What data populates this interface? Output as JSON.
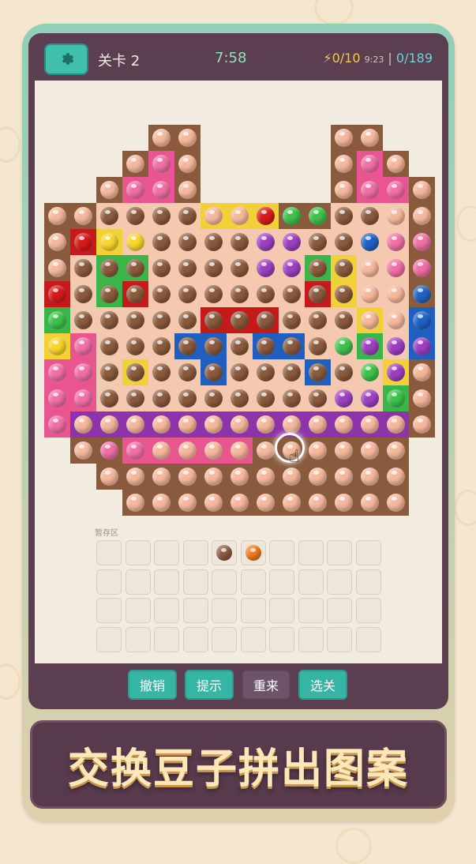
{
  "topbar": {
    "settings_icon": "gear-icon",
    "level_label": "关卡 2",
    "timer": "7:58",
    "energy_icon": "lightning-icon",
    "energy": "0/10",
    "energy_timer": "9:23",
    "separator": "|",
    "progress": "0/189"
  },
  "holding": {
    "label": "暂存区",
    "rows": 4,
    "cols": 10,
    "items": [
      {
        "slot": 4,
        "color": "brown"
      },
      {
        "slot": 5,
        "color": "orange"
      }
    ]
  },
  "bottom_buttons": [
    {
      "label": "撤销",
      "color": "#36b5a4"
    },
    {
      "label": "提示",
      "color": "#36b5a4"
    },
    {
      "label": "重来",
      "color": "#6e546a"
    },
    {
      "label": "选关",
      "color": "#36b5a4"
    }
  ],
  "banner": {
    "text": "交换豆子拼出图案"
  },
  "colors": {
    "peach": "#f6b79b",
    "brown": "#8a5a3c",
    "red": "#d8191b",
    "yellow": "#f7d52b",
    "green": "#3ec24a",
    "blue": "#1f63c6",
    "pink": "#f06fa4",
    "purple": "#9d3fc1",
    "orange": "#f07a1c"
  },
  "board": {
    "cols": 15,
    "rows": 15,
    "cells": [
      "....bb.....bb..",
      "...bPb.....bPb.",
      "..bPPb.....bPPb",
      "bbbbbbYYYbbbbbb",
      "bRYbbbbbbbbbbbb",
      "bbGGbbbbbbGYbbb",
      "RbGRbbbbbbRYbbb",
      "GbbbbbRRRbbbYbB",
      "YPbbbBBbBBbbGbB",
      "PPbYbbBbbbBbbYb",
      "PPbbbbbbbbbbbGb",
      "PVVVVVVVVVVVVVb",
      ".bbPPPPPbbbbbb.",
      "..bbbbbbbbbbbb.",
      "...bbbbbbbbbbb."
    ],
    "beads": [
      "....pp.....pp..",
      "...pPp.....pPp.",
      "..pPPp.....pPPp",
      "ppbbbbpprggbbpp",
      "pryybbbbVVbbBPP",
      "pbbbbbbbVVbbYPP",
      "rbbbbbbbbbbbYYB",
      "gbbbbbbbbbbbYYB",
      "yPbbbbbbbbbgVVV",
      "PPbbbbbbbbbbgVp",
      "PPbbbbbbbbbVVgp",
      "Ppppppppppppppp",
      ".pPPppppppppppp",
      "..ppppppppppppp",
      "...pppppppppppp"
    ]
  }
}
